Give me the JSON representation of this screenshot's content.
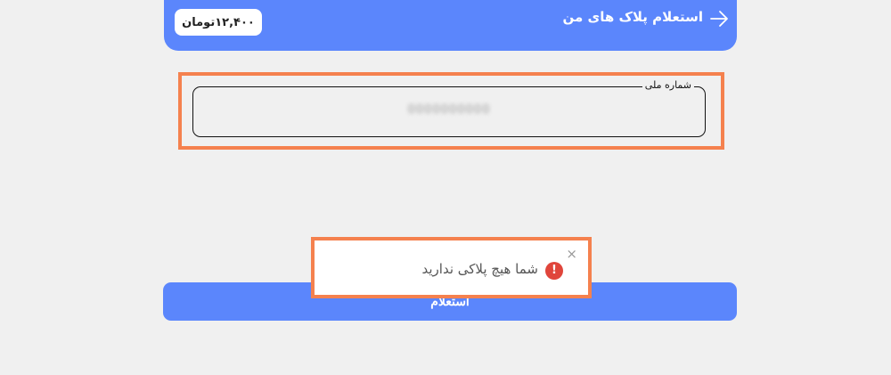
{
  "header": {
    "title": "استعلام پلاک های من",
    "price": "۱۲,۴۰۰تومان",
    "back_icon": "arrow-right-icon"
  },
  "national_id_field": {
    "label": "شماره ملی",
    "value": "0000000000"
  },
  "submit_button": {
    "label": "استعلام"
  },
  "toast": {
    "message": "شما هیچ پلاکی ندارید",
    "icon": "error-icon",
    "icon_glyph": "!",
    "close_glyph": "×"
  },
  "colors": {
    "primary": "#5b86fc",
    "highlight": "#f5814e",
    "error": "#e0453b",
    "background": "#f0f0f0"
  }
}
